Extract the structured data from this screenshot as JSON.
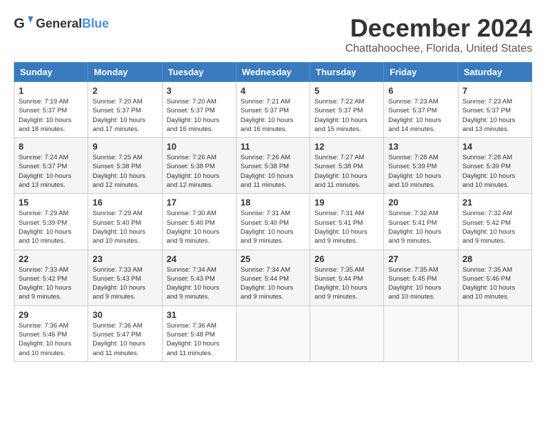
{
  "logo": {
    "text_general": "General",
    "text_blue": "Blue"
  },
  "title": {
    "month": "December 2024",
    "location": "Chattahoochee, Florida, United States"
  },
  "days_of_week": [
    "Sunday",
    "Monday",
    "Tuesday",
    "Wednesday",
    "Thursday",
    "Friday",
    "Saturday"
  ],
  "weeks": [
    [
      {
        "day": "1",
        "sunrise": "7:19 AM",
        "sunset": "5:37 PM",
        "daylight": "10 hours and 18 minutes."
      },
      {
        "day": "2",
        "sunrise": "7:20 AM",
        "sunset": "5:37 PM",
        "daylight": "10 hours and 17 minutes."
      },
      {
        "day": "3",
        "sunrise": "7:20 AM",
        "sunset": "5:37 PM",
        "daylight": "10 hours and 16 minutes."
      },
      {
        "day": "4",
        "sunrise": "7:21 AM",
        "sunset": "5:37 PM",
        "daylight": "10 hours and 16 minutes."
      },
      {
        "day": "5",
        "sunrise": "7:22 AM",
        "sunset": "5:37 PM",
        "daylight": "10 hours and 15 minutes."
      },
      {
        "day": "6",
        "sunrise": "7:23 AM",
        "sunset": "5:37 PM",
        "daylight": "10 hours and 14 minutes."
      },
      {
        "day": "7",
        "sunrise": "7:23 AM",
        "sunset": "5:37 PM",
        "daylight": "10 hours and 13 minutes."
      }
    ],
    [
      {
        "day": "8",
        "sunrise": "7:24 AM",
        "sunset": "5:37 PM",
        "daylight": "10 hours and 13 minutes."
      },
      {
        "day": "9",
        "sunrise": "7:25 AM",
        "sunset": "5:38 PM",
        "daylight": "10 hours and 12 minutes."
      },
      {
        "day": "10",
        "sunrise": "7:26 AM",
        "sunset": "5:38 PM",
        "daylight": "10 hours and 12 minutes."
      },
      {
        "day": "11",
        "sunrise": "7:26 AM",
        "sunset": "5:38 PM",
        "daylight": "10 hours and 11 minutes."
      },
      {
        "day": "12",
        "sunrise": "7:27 AM",
        "sunset": "5:38 PM",
        "daylight": "10 hours and 11 minutes."
      },
      {
        "day": "13",
        "sunrise": "7:28 AM",
        "sunset": "5:39 PM",
        "daylight": "10 hours and 10 minutes."
      },
      {
        "day": "14",
        "sunrise": "7:28 AM",
        "sunset": "5:39 PM",
        "daylight": "10 hours and 10 minutes."
      }
    ],
    [
      {
        "day": "15",
        "sunrise": "7:29 AM",
        "sunset": "5:39 PM",
        "daylight": "10 hours and 10 minutes."
      },
      {
        "day": "16",
        "sunrise": "7:29 AM",
        "sunset": "5:40 PM",
        "daylight": "10 hours and 10 minutes."
      },
      {
        "day": "17",
        "sunrise": "7:30 AM",
        "sunset": "5:40 PM",
        "daylight": "10 hours and 9 minutes."
      },
      {
        "day": "18",
        "sunrise": "7:31 AM",
        "sunset": "5:40 PM",
        "daylight": "10 hours and 9 minutes."
      },
      {
        "day": "19",
        "sunrise": "7:31 AM",
        "sunset": "5:41 PM",
        "daylight": "10 hours and 9 minutes."
      },
      {
        "day": "20",
        "sunrise": "7:32 AM",
        "sunset": "5:41 PM",
        "daylight": "10 hours and 9 minutes."
      },
      {
        "day": "21",
        "sunrise": "7:32 AM",
        "sunset": "5:42 PM",
        "daylight": "10 hours and 9 minutes."
      }
    ],
    [
      {
        "day": "22",
        "sunrise": "7:33 AM",
        "sunset": "5:42 PM",
        "daylight": "10 hours and 9 minutes."
      },
      {
        "day": "23",
        "sunrise": "7:33 AM",
        "sunset": "5:43 PM",
        "daylight": "10 hours and 9 minutes."
      },
      {
        "day": "24",
        "sunrise": "7:34 AM",
        "sunset": "5:43 PM",
        "daylight": "10 hours and 9 minutes."
      },
      {
        "day": "25",
        "sunrise": "7:34 AM",
        "sunset": "5:44 PM",
        "daylight": "10 hours and 9 minutes."
      },
      {
        "day": "26",
        "sunrise": "7:35 AM",
        "sunset": "5:44 PM",
        "daylight": "10 hours and 9 minutes."
      },
      {
        "day": "27",
        "sunrise": "7:35 AM",
        "sunset": "5:45 PM",
        "daylight": "10 hours and 10 minutes."
      },
      {
        "day": "28",
        "sunrise": "7:35 AM",
        "sunset": "5:46 PM",
        "daylight": "10 hours and 10 minutes."
      }
    ],
    [
      {
        "day": "29",
        "sunrise": "7:36 AM",
        "sunset": "5:46 PM",
        "daylight": "10 hours and 10 minutes."
      },
      {
        "day": "30",
        "sunrise": "7:36 AM",
        "sunset": "5:47 PM",
        "daylight": "10 hours and 11 minutes."
      },
      {
        "day": "31",
        "sunrise": "7:36 AM",
        "sunset": "5:48 PM",
        "daylight": "10 hours and 11 minutes."
      },
      null,
      null,
      null,
      null
    ]
  ]
}
